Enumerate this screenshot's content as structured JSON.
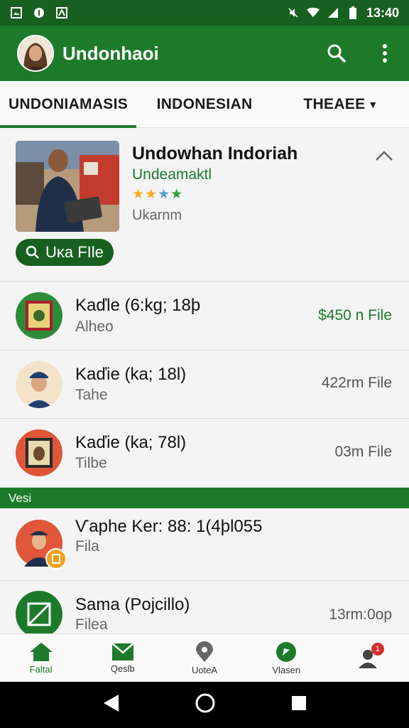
{
  "status_bar": {
    "time": "13:40",
    "icons": [
      "image-icon",
      "notification-icon",
      "app-icon",
      "mute-icon",
      "wifi-icon",
      "signal-icon",
      "battery-icon"
    ]
  },
  "app_bar": {
    "title": "Undonhaoi",
    "actions": [
      "search-icon",
      "more-vert-icon"
    ]
  },
  "tabs": [
    {
      "label": "UNDONIAMASIS",
      "active": true
    },
    {
      "label": "INDONESIAN",
      "active": false
    },
    {
      "label": "THEAEE",
      "active": false,
      "has_dropdown": true
    }
  ],
  "featured": {
    "title": "Undowhan Indoriah",
    "subtitle": "Undeamaktl",
    "stars": "★★★★",
    "meta": "Ukarnm",
    "button_label": "Uĸa FIle"
  },
  "list": [
    {
      "title": "Kaďle (6:kg; 18ϸ",
      "subtitle": "Alheo",
      "trailing": "$450 n File",
      "trailing_green": true
    },
    {
      "title": "Kaďie (ka; 18l)",
      "subtitle": "Tahe",
      "trailing": "422rm File",
      "trailing_green": false
    },
    {
      "title": "Kaďie (ka; 78l)",
      "subtitle": "Tilbe",
      "trailing": "03m File",
      "trailing_green": false
    }
  ],
  "section_header": "Vesi",
  "list2": [
    {
      "title": "Ѵaphe Ker: 88: 1(4ϸl055",
      "subtitle": "Fila",
      "trailing": ""
    },
    {
      "title": "Sama (Pojcillo)",
      "subtitle": "Filea",
      "trailing": "13rm:0op"
    }
  ],
  "bottom_nav": [
    {
      "label": "Faltal",
      "icon": "home-icon",
      "active": true
    },
    {
      "label": "Qeslb",
      "icon": "mail-icon",
      "active": false
    },
    {
      "label": "UoteA",
      "icon": "location-pin-icon",
      "active": false
    },
    {
      "label": "Vlasen",
      "icon": "navigation-icon",
      "active": false
    },
    {
      "label": "",
      "icon": "person-icon",
      "active": false,
      "badge": "1"
    }
  ],
  "colors": {
    "primary": "#1e7a2b",
    "primary_dark": "#17601f",
    "badge": "#d32f2f"
  }
}
